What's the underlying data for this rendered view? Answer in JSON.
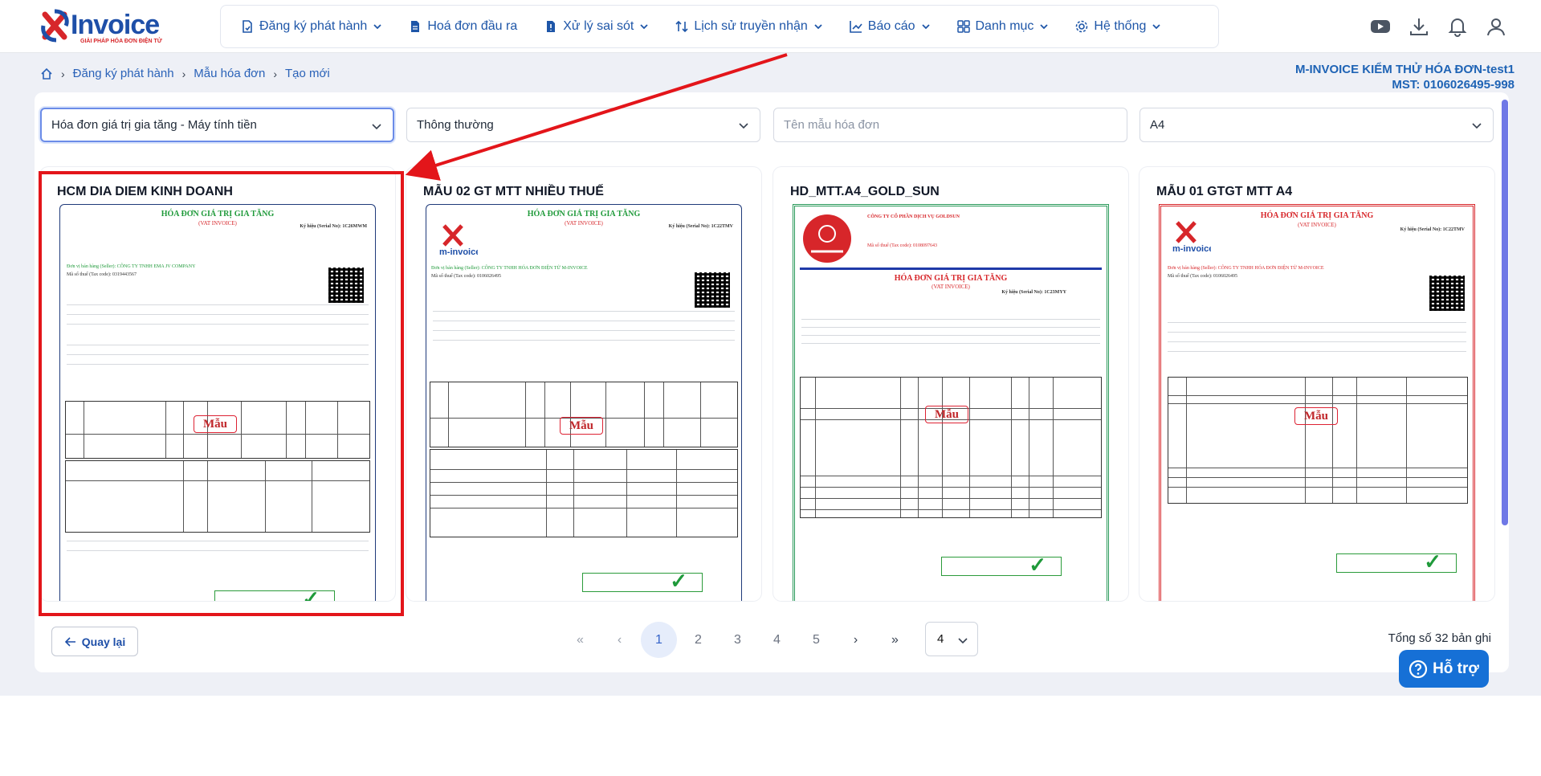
{
  "header": {
    "logo_text": "Invoice",
    "logo_tagline": "GIẢI PHÁP HÓA ĐƠN ĐIỆN TỬ",
    "nav": [
      {
        "label": "Đăng ký phát hành",
        "icon": "file-register-icon",
        "has_menu": true
      },
      {
        "label": "Hoá đơn đầu ra",
        "icon": "file-output-icon",
        "has_menu": false
      },
      {
        "label": "Xử lý sai sót",
        "icon": "file-error-icon",
        "has_menu": true
      },
      {
        "label": "Lịch sử truyền nhận",
        "icon": "sort-arrows-icon",
        "has_menu": true
      },
      {
        "label": "Báo cáo",
        "icon": "chart-icon",
        "has_menu": true
      },
      {
        "label": "Danh mục",
        "icon": "grid-icon",
        "has_menu": true
      },
      {
        "label": "Hệ thống",
        "icon": "gear-icon",
        "has_menu": true
      }
    ],
    "right_icons": [
      "youtube-icon",
      "download-icon",
      "bell-icon",
      "user-icon"
    ]
  },
  "breadcrumb": {
    "home_icon": "home-icon",
    "items": [
      "Đăng ký phát hành",
      "Mẫu hóa đơn",
      "Tạo mới"
    ]
  },
  "company": {
    "name": "M-INVOICE KIỂM THỬ HÓA ĐƠN-test1",
    "tax_code": "MST: 0106026495-998"
  },
  "filters": {
    "invoice_type": "Hóa đơn giá trị gia tăng - Máy tính tiền",
    "template_style": "Thông thường",
    "template_name_placeholder": "Tên mẫu hóa đơn",
    "paper_size": "A4"
  },
  "cards": [
    {
      "title": "HCM DIA DIEM KINH DOANH",
      "invoice_title": "HÓA ĐƠN GIÁ TRỊ GIA TĂNG",
      "invoice_subtitle": "(VAT INVOICE)",
      "serial": "Ký hiệu (Serial No): 1C26MWM",
      "seller": "Đơn vị bán hàng (Seller): CÔNG TY TNHH EMA JV COMPANY",
      "tax": "Mã số thuế (Tax code): 0319443567",
      "sample_mark": "Mẫu"
    },
    {
      "title": "MẪU 02 GT MTT NHIỀU THUẾ",
      "invoice_title": "HÓA ĐƠN GIÁ TRỊ GIA TĂNG",
      "invoice_subtitle": "(VAT INVOICE)",
      "serial": "Ký hiệu (Serial No): 1C22TMV",
      "seller": "Đơn vị bán hàng (Seller): CÔNG TY TNHH HÓA ĐƠN ĐIỆN TỬ M-INVOICE",
      "tax": "Mã số thuế (Tax code): 0106026495",
      "sample_mark": "Mẫu"
    },
    {
      "title": "HD_MTT.A4_GOLD_SUN",
      "invoice_title": "HÓA ĐƠN GIÁ TRỊ GIA TĂNG",
      "invoice_subtitle": "(VAT INVOICE)",
      "serial": "Ký hiệu (Serial No): 1C23MYY",
      "seller": "CÔNG TY CỔ PHẦN DỊCH VỤ GOLDSUN",
      "tax": "Mã số thuế (Tax code): 0108097643",
      "sample_mark": "Mẫu"
    },
    {
      "title": "MẪU 01 GTGT MTT A4",
      "invoice_title": "HÓA ĐƠN GIÁ TRỊ GIA TĂNG",
      "invoice_subtitle": "(VAT INVOICE)",
      "serial": "Ký hiệu (Serial No): 1C22TMV",
      "seller": "Đơn vị bán hàng (Seller): CÔNG TY TNHH HÓA ĐƠN ĐIỆN TỬ M-INVOICE",
      "tax": "Mã số thuế (Tax code): 0106026495",
      "sample_mark": "Mẫu"
    }
  ],
  "footer": {
    "back_label": "Quay lại",
    "pages": [
      "1",
      "2",
      "3",
      "4",
      "5"
    ],
    "current_page": "1",
    "page_size": "4",
    "total": "Tổng số 32 bản ghi",
    "help_label": "Hỗ trợ"
  },
  "colors": {
    "accent": "#1e56a8",
    "highlight": "#e3151a",
    "help_button": "#1670d6",
    "invoice_green": "#1f9a3a",
    "invoice_red": "#d7262a"
  }
}
